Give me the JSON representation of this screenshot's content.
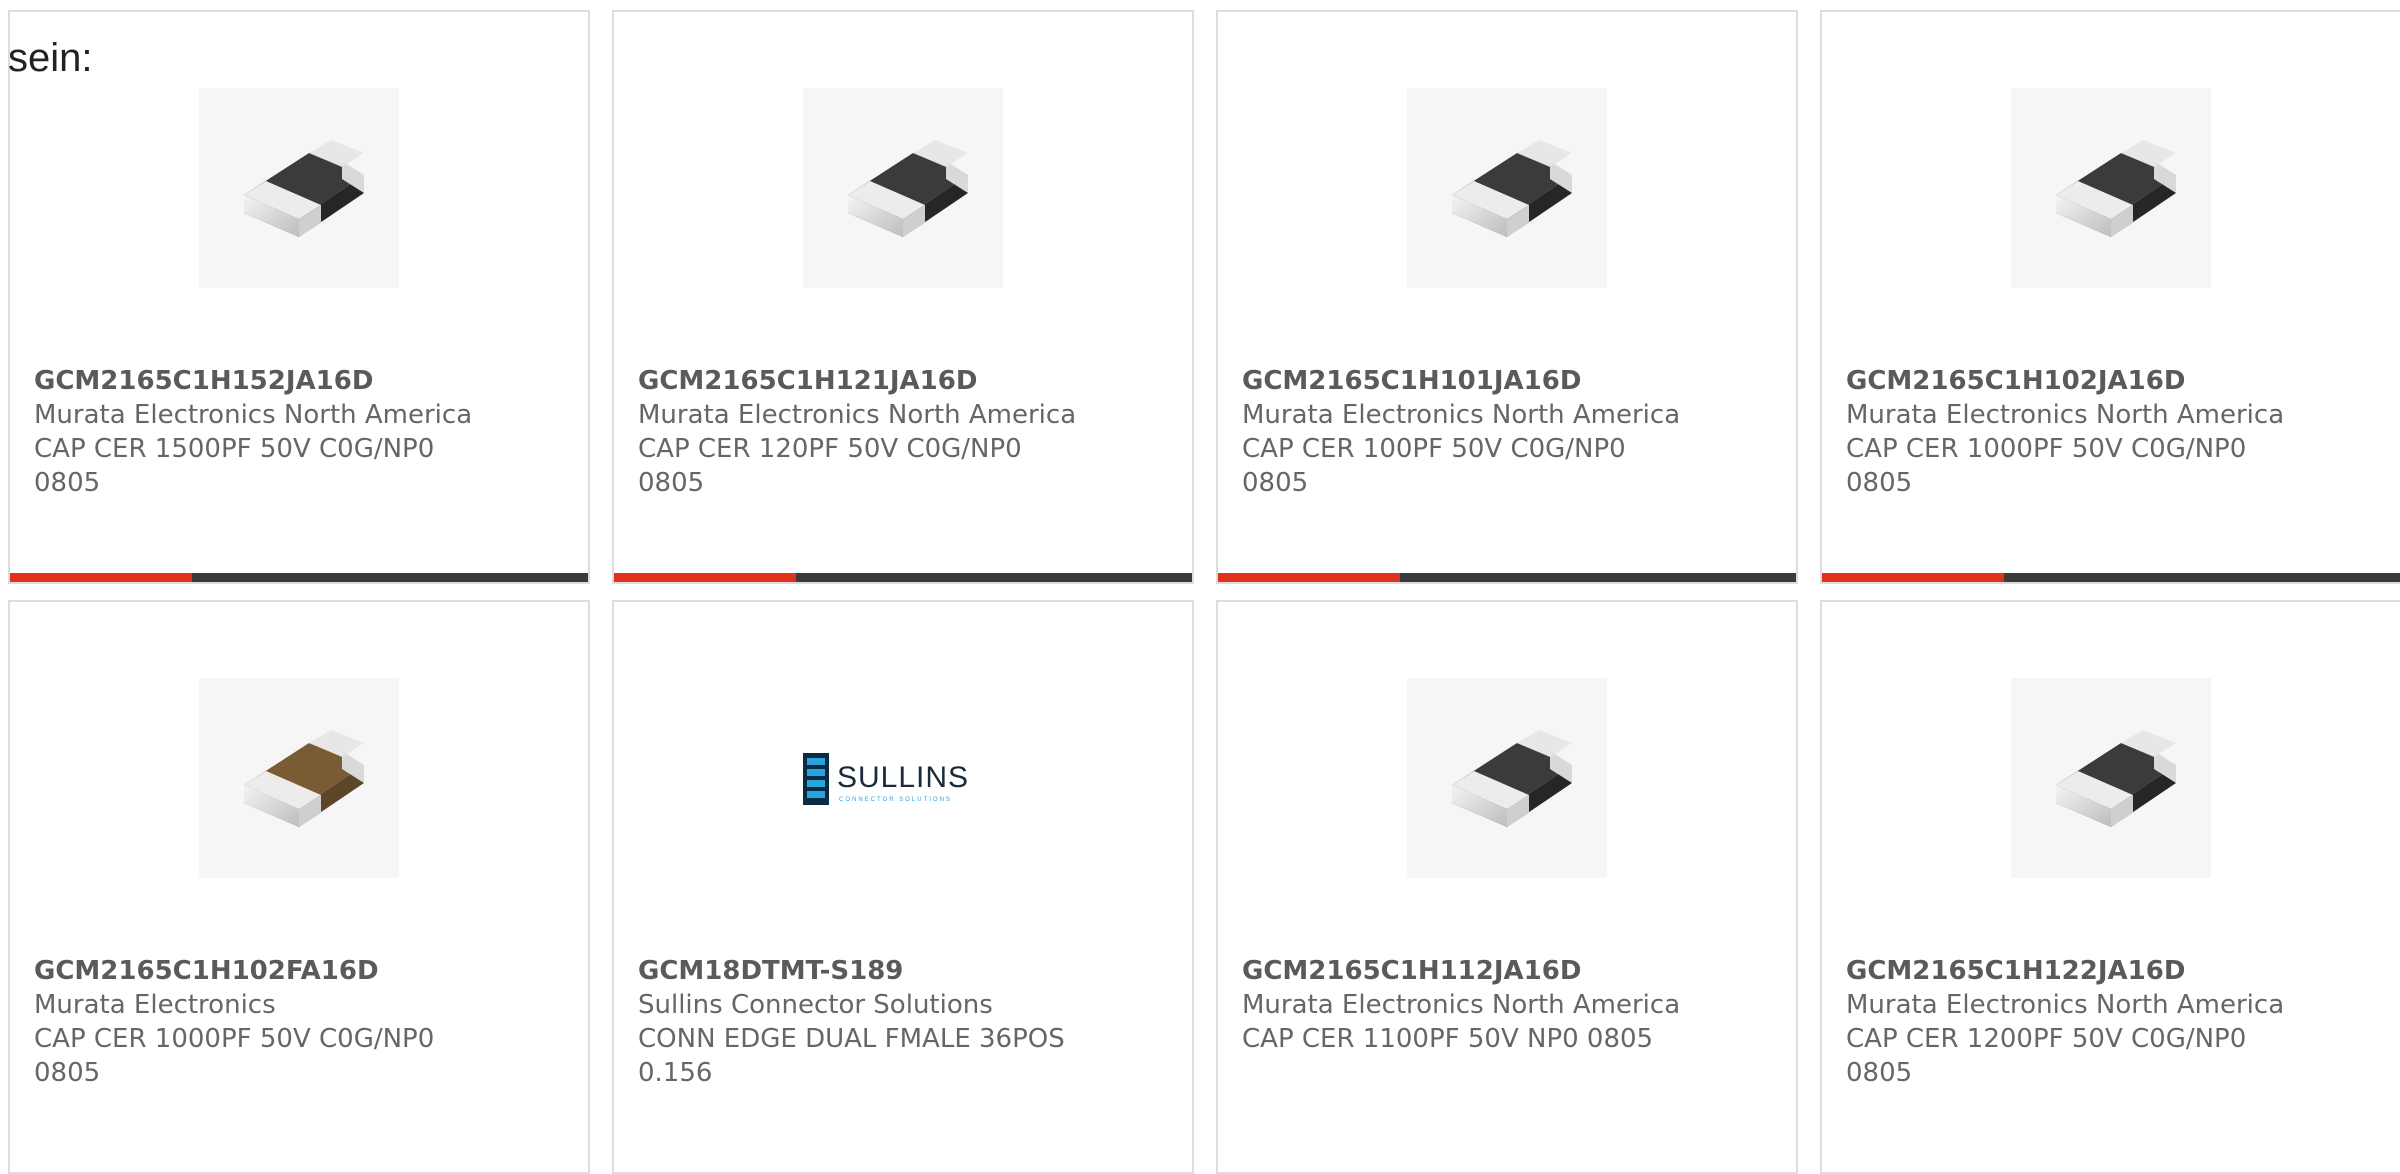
{
  "lead_text": "sein:",
  "accent_color": "#e0301e",
  "bar_color": "#3a3a3a",
  "cards": [
    {
      "part_number": "GCM2165C1H152JA16D",
      "manufacturer": "Murata Electronics North America",
      "description": "CAP CER 1500PF 50V C0G/NP0 0805",
      "image": "chip-capacitor-dark"
    },
    {
      "part_number": "GCM2165C1H121JA16D",
      "manufacturer": "Murata Electronics North America",
      "description": "CAP CER 120PF 50V C0G/NP0 0805",
      "image": "chip-capacitor-dark"
    },
    {
      "part_number": "GCM2165C1H101JA16D",
      "manufacturer": "Murata Electronics North America",
      "description": "CAP CER 100PF 50V C0G/NP0 0805",
      "image": "chip-capacitor-dark"
    },
    {
      "part_number": "GCM2165C1H102JA16D",
      "manufacturer": "Murata Electronics North America",
      "description": "CAP CER 1000PF 50V C0G/NP0 0805",
      "image": "chip-capacitor-dark"
    },
    {
      "part_number": "GCM2165C1H102FA16D",
      "manufacturer": "Murata Electronics",
      "description": "CAP CER 1000PF 50V C0G/NP0 0805",
      "image": "chip-capacitor-brown"
    },
    {
      "part_number": "GCM18DTMT-S189",
      "manufacturer": "Sullins Connector Solutions",
      "description": "CONN EDGE DUAL FMALE 36POS 0.156",
      "image": "sullins-logo",
      "logo_text": "SULLINS",
      "logo_subtext": "CONNECTOR SOLUTIONS"
    },
    {
      "part_number": "GCM2165C1H112JA16D",
      "manufacturer": "Murata Electronics North America",
      "description": "CAP CER 1100PF 50V NP0 0805",
      "image": "chip-capacitor-dark"
    },
    {
      "part_number": "GCM2165C1H122JA16D",
      "manufacturer": "Murata Electronics North America",
      "description": "CAP CER 1200PF 50V C0G/NP0 0805",
      "image": "chip-capacitor-dark"
    }
  ]
}
